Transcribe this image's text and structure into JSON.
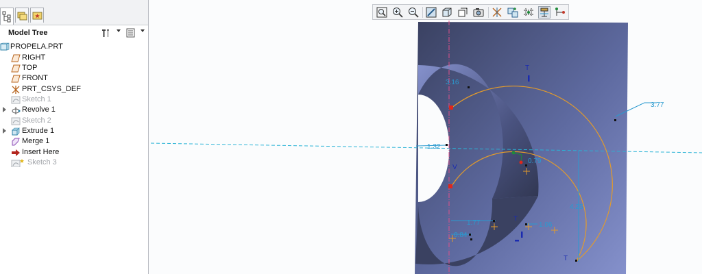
{
  "nav_tabs": [
    {
      "name": "model-tree-tab",
      "icon": "model-tree-icon",
      "active": true
    },
    {
      "name": "folder-browser-tab",
      "icon": "folder-icon",
      "active": false
    },
    {
      "name": "favorites-tab",
      "icon": "star-icon",
      "active": false
    }
  ],
  "model_tree": {
    "title": "Model Tree",
    "settings_icon": "tools-icon",
    "show_icon": "list-icon",
    "items": [
      {
        "label": "PROPELA.PRT",
        "icon": "part-icon",
        "indent": 0,
        "dimmed": false,
        "expandable": false
      },
      {
        "label": "RIGHT",
        "icon": "datum-plane-icon",
        "indent": 1,
        "dimmed": false,
        "expandable": false
      },
      {
        "label": "TOP",
        "icon": "datum-plane-icon",
        "indent": 1,
        "dimmed": false,
        "expandable": false
      },
      {
        "label": "FRONT",
        "icon": "datum-plane-icon",
        "indent": 1,
        "dimmed": false,
        "expandable": false
      },
      {
        "label": "PRT_CSYS_DEF",
        "icon": "csys-icon",
        "indent": 1,
        "dimmed": false,
        "expandable": false
      },
      {
        "label": "Sketch 1",
        "icon": "sketch-icon",
        "indent": 1,
        "dimmed": true,
        "expandable": false
      },
      {
        "label": "Revolve 1",
        "icon": "revolve-icon",
        "indent": 1,
        "dimmed": false,
        "expandable": true
      },
      {
        "label": "Sketch 2",
        "icon": "sketch-icon",
        "indent": 1,
        "dimmed": true,
        "expandable": false
      },
      {
        "label": "Extrude 1",
        "icon": "extrude-icon",
        "indent": 1,
        "dimmed": false,
        "expandable": true
      },
      {
        "label": "Merge 1",
        "icon": "merge-icon",
        "indent": 1,
        "dimmed": false,
        "expandable": false
      },
      {
        "label": "Insert Here",
        "icon": "insert-arrow-icon",
        "indent": 1,
        "dimmed": false,
        "expandable": false
      },
      {
        "label": "Sketch 3",
        "icon": "sketch-active-icon",
        "indent": 1,
        "dimmed": true,
        "expandable": false
      }
    ]
  },
  "graphics_toolbar": [
    {
      "name": "refit-button",
      "icon": "refit-icon"
    },
    {
      "name": "zoom-in-button",
      "icon": "zoom-in-icon"
    },
    {
      "name": "zoom-out-button",
      "icon": "zoom-out-icon"
    },
    {
      "name": "repaint-button",
      "icon": "repaint-icon"
    },
    {
      "name": "display-style-button",
      "icon": "display-style-icon"
    },
    {
      "name": "saved-views-button",
      "icon": "saved-views-icon"
    },
    {
      "name": "view-manager-button",
      "icon": "view-manager-icon"
    },
    {
      "name": "datum-display-button",
      "icon": "datum-display-icon"
    },
    {
      "name": "spin-center-button",
      "icon": "spin-center-icon"
    },
    {
      "name": "sketch-view-button",
      "icon": "sketch-view-icon"
    },
    {
      "name": "dimension-display-button",
      "icon": "dimension-display-icon"
    },
    {
      "name": "constraint-display-button",
      "icon": "constraint-display-icon"
    }
  ],
  "sketch": {
    "dimensions": [
      "3.16",
      "3.77",
      "1.32",
      "0.79",
      "4.25",
      "1.77",
      "1.06",
      "0.84"
    ],
    "constraint_labels": [
      "T",
      "T",
      "T",
      "V"
    ],
    "colors": {
      "part_dark": "#3a4161",
      "part_light": "#8591cc",
      "arc": "#e39b2b",
      "dimension": "#2a9ad0",
      "centerline": "#e0508a"
    }
  }
}
